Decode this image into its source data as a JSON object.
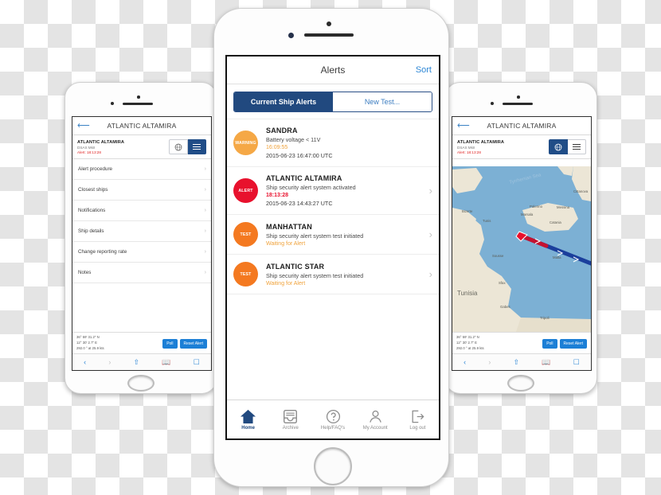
{
  "colors": {
    "navy": "#21497f",
    "blue_link": "#2f88d6",
    "alert_red": "#e8112d",
    "test_orange": "#f47920",
    "warning_orange": "#f5a846",
    "button_blue": "#1c7fd6"
  },
  "left_phone": {
    "nav": {
      "back_icon": "back-arrow-icon",
      "title": "ATLANTIC ALTAMIRA"
    },
    "ship_header": {
      "name": "ATLANTIC ALTAMIRA",
      "model": "DSAS MkII",
      "alert": "Alert: 18:13:28",
      "globe_icon": "globe-icon",
      "menu_icon": "hamburger-menu-icon",
      "active_view": "menu"
    },
    "menu_items": [
      {
        "label": "Alert procedure"
      },
      {
        "label": "Closest ships"
      },
      {
        "label": "Notifications"
      },
      {
        "label": "Ship details"
      },
      {
        "label": "Change reporting rate"
      },
      {
        "label": "Notes"
      }
    ],
    "status": {
      "latitude": "36° 59' 31.2\" N",
      "longitude": "12° 30' 2.7\" E",
      "heading_speed": "292.0 ° at 25.9 kts",
      "poll_label": "Poll",
      "reset_label": "Reset Alert"
    },
    "browser_bar": {
      "back_icon": "chevron-left-icon",
      "forward_icon": "chevron-right-icon",
      "share_icon": "share-icon",
      "bookmarks_icon": "book-icon",
      "tabs_icon": "tabs-icon"
    }
  },
  "center_phone": {
    "nav": {
      "title": "Alerts",
      "sort_label": "Sort"
    },
    "segmented": {
      "selected_label": "Current Ship Alerts",
      "unselected_label": "New Test..."
    },
    "alerts": [
      {
        "badge": "WARNING",
        "badge_type": "warning",
        "title": "SANDRA",
        "description": "Battery voltage < 11V",
        "time": "16:09:55",
        "date": "2015-06-23 16:47:00 UTC",
        "chevron": false
      },
      {
        "badge": "ALERT",
        "badge_type": "alert",
        "title": "ATLANTIC ALTAMIRA",
        "description": "Ship security alert system activated",
        "time": "18:13:28",
        "date": "2015-06-23 14:43:27 UTC",
        "chevron": true
      },
      {
        "badge": "TEST",
        "badge_type": "test",
        "title": "MANHATTAN",
        "description": "Ship security alert system test initiated",
        "time": "Waiting for Alert",
        "date": "",
        "chevron": true
      },
      {
        "badge": "TEST",
        "badge_type": "test",
        "title": "ATLANTIC STAR",
        "description": "Ship security alert system test initiated",
        "time": "Waiting for Alert",
        "date": "",
        "chevron": true
      }
    ],
    "tabs": [
      {
        "label": "Home",
        "icon": "home-icon",
        "active": true
      },
      {
        "label": "Archive",
        "icon": "archive-tray-icon",
        "active": false
      },
      {
        "label": "Help/FAQ's",
        "icon": "question-circle-icon",
        "active": false
      },
      {
        "label": "My Account",
        "icon": "person-icon",
        "active": false
      },
      {
        "label": "Log out",
        "icon": "logout-arrow-icon",
        "active": false
      }
    ]
  },
  "right_phone": {
    "nav": {
      "back_icon": "back-arrow-icon",
      "title": "ATLANTIC ALTAMIRA"
    },
    "ship_header": {
      "name": "ATLANTIC ALTAMIRA",
      "model": "DSAS MkII",
      "alert": "Alert: 18:13:28",
      "globe_icon": "globe-icon",
      "menu_icon": "hamburger-menu-icon",
      "active_view": "map"
    },
    "map": {
      "sea_label": "Tyrrhenian Sea",
      "country_label": "Tunisia",
      "places": [
        {
          "name": "Palermo"
        },
        {
          "name": "Marsala"
        },
        {
          "name": "Catania"
        },
        {
          "name": "Messina"
        },
        {
          "name": "Cittanova"
        },
        {
          "name": "Bizerte"
        },
        {
          "name": "Tunis"
        },
        {
          "name": "Sousse"
        },
        {
          "name": "Sfax"
        },
        {
          "name": "Malta"
        },
        {
          "name": "Tripoli"
        },
        {
          "name": "Gabes"
        }
      ],
      "vessel_marker": "vessel-position-marker",
      "track_label": "vessel-track-line"
    },
    "status": {
      "latitude": "36° 59' 31.2\" N",
      "longitude": "12° 30' 2.7\" E",
      "heading_speed": "292.0 ° at 25.9 kts",
      "poll_label": "Poll",
      "reset_label": "Reset Alert"
    }
  }
}
